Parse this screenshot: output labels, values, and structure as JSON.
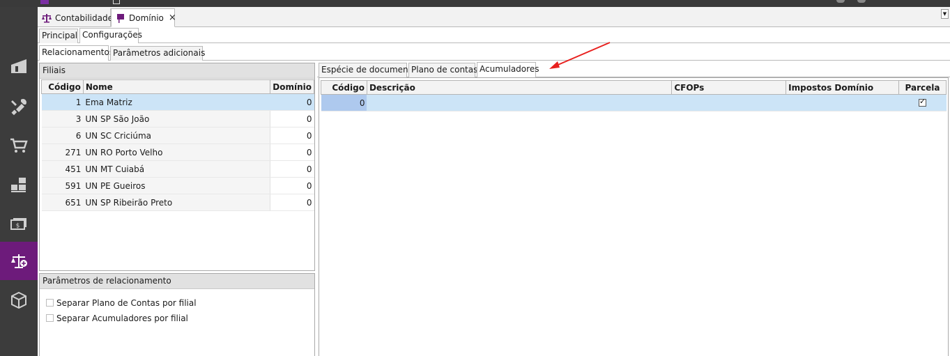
{
  "doc_tabs": [
    {
      "label": "Contabilidade",
      "icon": "scale-icon"
    },
    {
      "label": "Domínio",
      "icon": "flag-icon",
      "close": "×"
    }
  ],
  "sidebar": {
    "items": [
      {
        "name": "warehouse-icon",
        "active": false
      },
      {
        "name": "tools-icon",
        "active": false
      },
      {
        "name": "cart-icon",
        "active": false
      },
      {
        "name": "boxes-icon",
        "active": false
      },
      {
        "name": "money-icon",
        "active": false
      },
      {
        "name": "accounting-scale-icon",
        "active": true
      },
      {
        "name": "package-icon",
        "active": false
      }
    ]
  },
  "tabs_level1": [
    "Principal",
    "Configurações"
  ],
  "tabs_level2": [
    "Relacionamentos",
    "Parâmetros adicionais"
  ],
  "filiais": {
    "title": "Filiais",
    "columns": [
      "Código",
      "Nome",
      "Domínio"
    ],
    "rows": [
      {
        "codigo": "1",
        "nome": "Ema Matriz",
        "dominio": "0"
      },
      {
        "codigo": "3",
        "nome": "UN SP São João",
        "dominio": "0"
      },
      {
        "codigo": "6",
        "nome": "UN SC Criciúma",
        "dominio": "0"
      },
      {
        "codigo": "271",
        "nome": "UN RO Porto Velho",
        "dominio": "0"
      },
      {
        "codigo": "451",
        "nome": "UN MT Cuiabá",
        "dominio": "0"
      },
      {
        "codigo": "591",
        "nome": "UN PE Gueiros",
        "dominio": "0"
      },
      {
        "codigo": "651",
        "nome": "UN SP Ribeirão Preto",
        "dominio": "0"
      }
    ]
  },
  "parametros": {
    "title": "Parâmetros de relacionamento",
    "options": [
      {
        "label": "Separar Plano de Contas por filial",
        "checked": false
      },
      {
        "label": "Separar Acumuladores por filial",
        "checked": false
      }
    ]
  },
  "tabs_right": [
    "Espécie de documento",
    "Plano de contas",
    "Acumuladores"
  ],
  "acumuladores": {
    "columns": [
      "Código",
      "Descrição",
      "CFOPs",
      "Impostos Domínio",
      "Parcela"
    ],
    "rows": [
      {
        "codigo": "0",
        "descricao": "",
        "cfops": "",
        "impostos": "",
        "parcela": true
      }
    ]
  },
  "colors": {
    "sidebar_bg": "#3c3c3c",
    "sidebar_active": "#6d1b7b",
    "selected_row": "#cce4f7",
    "annotation_arrow": "#e8201e"
  }
}
